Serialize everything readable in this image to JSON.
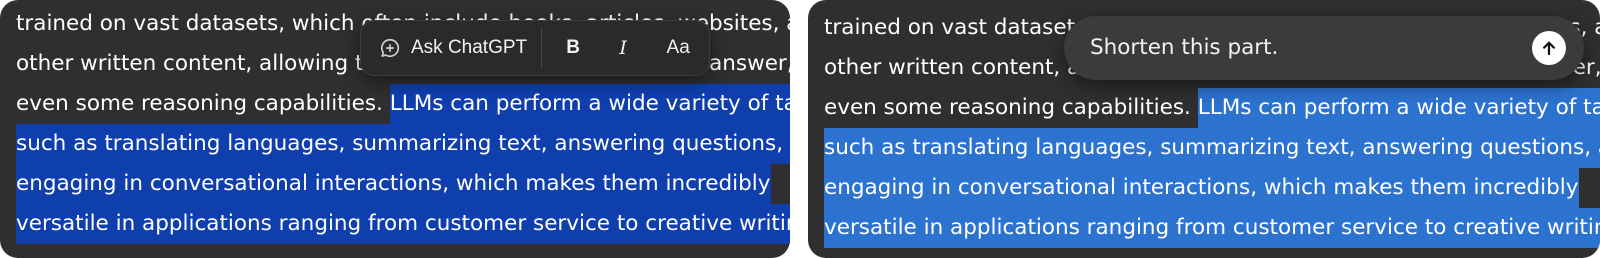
{
  "left_panel": {
    "lines": [
      {
        "plain": "trained on vast datasets, which often include books, articles, websites, and",
        "selected": ""
      },
      {
        "plain": "other written content, allowing them to generate coherent text, answer, and",
        "selected": ""
      },
      {
        "plain": "even some reasoning capabilities. ",
        "selected": "LLMs can perform a wide variety of tasks"
      },
      {
        "plain": "",
        "selected": "such as translating languages, summarizing text, answering questions, and"
      },
      {
        "plain": "",
        "selected": "engaging in conversational interactions, which makes them incredibly"
      },
      {
        "plain": "",
        "selected": "versatile in applications ranging from customer service to creative writing."
      }
    ],
    "toolbar": {
      "ask_label": "Ask ChatGPT",
      "bold_label": "B",
      "italic_label": "I",
      "font_label": "Aa"
    }
  },
  "right_panel": {
    "lines": [
      {
        "plain": "trained on vast datasets, which often include books, articles, websites, and",
        "selected": ""
      },
      {
        "plain": "other written content, allowing them to generate coherent text, answer, and",
        "selected": ""
      },
      {
        "plain": "even some reasoning capabilities. ",
        "selected": "LLMs can perform a wide variety of tasks"
      },
      {
        "plain": "",
        "selected": "such as translating languages, summarizing text, answering questions, and"
      },
      {
        "plain": "",
        "selected": "engaging in conversational interactions, which makes them incredibly"
      },
      {
        "plain": "",
        "selected": "versatile in applications ranging from customer service to creative writing."
      }
    ],
    "prompt": {
      "text": "Shorten this part.",
      "send_icon": "arrow-up-icon"
    }
  },
  "colors": {
    "panel_bg": "#2f2f2f",
    "selection_left": "#0f3fad",
    "selection_right": "#2c73cf",
    "text": "#ffffff"
  }
}
